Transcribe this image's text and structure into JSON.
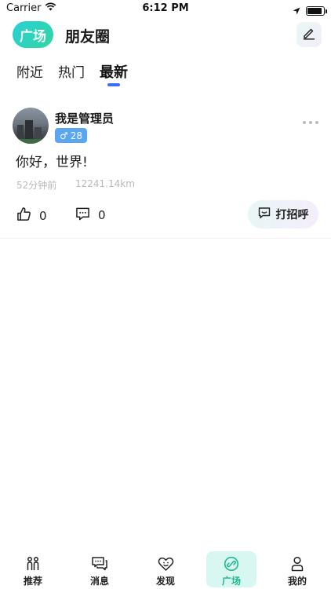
{
  "status_bar": {
    "carrier": "Carrier",
    "time": "6:12 PM",
    "battery_level": 0.9
  },
  "header": {
    "badge_label": "广场",
    "title": "朋友圈"
  },
  "tabs": [
    {
      "label": "附近",
      "active": false
    },
    {
      "label": "热门",
      "active": false
    },
    {
      "label": "最新",
      "active": true
    }
  ],
  "post": {
    "username": "我是管理员",
    "gender_symbol": "♂",
    "age": "28",
    "content": "你好，世界!",
    "time_ago": "52分钟前",
    "distance": "12241.14km",
    "likes": "0",
    "comments": "0",
    "greet_label": "打招呼"
  },
  "bottom_nav": [
    {
      "label": "推荐",
      "icon": "people-icon",
      "active": false
    },
    {
      "label": "消息",
      "icon": "chat-icon",
      "active": false
    },
    {
      "label": "发现",
      "icon": "heart-smile-icon",
      "active": false
    },
    {
      "label": "广场",
      "icon": "link-circle-icon",
      "active": true
    },
    {
      "label": "我的",
      "icon": "person-icon",
      "active": false
    }
  ],
  "colors": {
    "accent": "#3d6cf0",
    "brand_green": "#2fd7a0",
    "gender_blue": "#5aa7ef",
    "nav_active": "#1fb890"
  }
}
